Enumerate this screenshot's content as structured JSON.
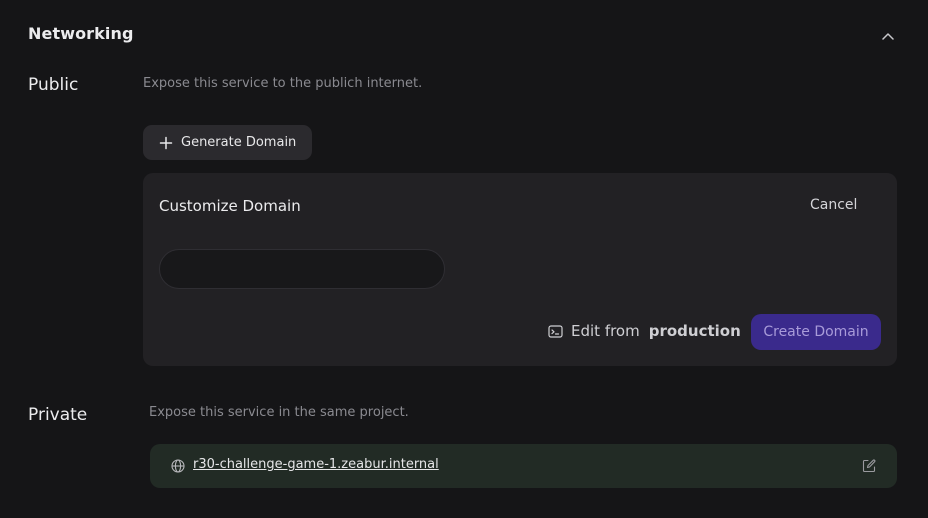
{
  "networking": {
    "title": "Networking",
    "collapse_icon": "chevron-up-icon"
  },
  "public": {
    "label": "Public",
    "description": "Expose this service to the publich internet.",
    "generate_button": {
      "label": "Generate Domain",
      "icon": "plus-icon"
    },
    "customize_panel": {
      "title": "Customize Domain",
      "cancel_label": "Cancel",
      "domain_input": {
        "value": "",
        "placeholder": ""
      },
      "edit_from": {
        "icon": "terminal-icon",
        "label": "Edit from",
        "environment": "production"
      },
      "create_button_label": "Create Domain"
    }
  },
  "private": {
    "label": "Private",
    "description": "Expose this service in the same project.",
    "hostname": "r30-challenge-game-1.zeabur.internal",
    "hostname_icon": "globe-icon",
    "edit_icon": "edit-icon"
  },
  "colors": {
    "background": "#151517",
    "panel": "#222124",
    "primary_button": "#3a2a8c",
    "private_row": "#222b25"
  }
}
